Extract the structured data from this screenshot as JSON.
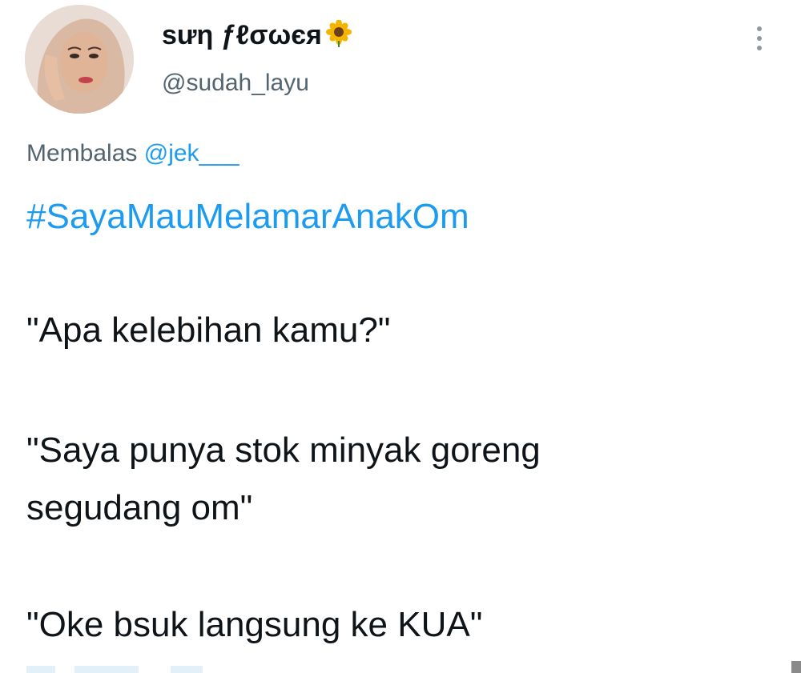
{
  "tweet": {
    "author": {
      "display_name": "sưη ƒℓσωєя",
      "name_emoji": "sunflower-emoji",
      "handle": "@sudah_layu",
      "avatar": "profile-photo"
    },
    "more_icon": "more-vertical-icon",
    "reply": {
      "prefix": "Membalas",
      "mention": "@jek___"
    },
    "hashtag": "#SayaMauMelamarAnakOm",
    "lines": [
      "\"Apa kelebihan kamu?\"",
      "\"Saya punya stok minyak goreng",
      "segudang om\"",
      "\"Oke bsuk langsung ke KUA\""
    ]
  },
  "colors": {
    "link": "#1d9bf0",
    "secondary_text": "#536471",
    "primary_text": "#0f1419",
    "background": "#ffffff"
  }
}
